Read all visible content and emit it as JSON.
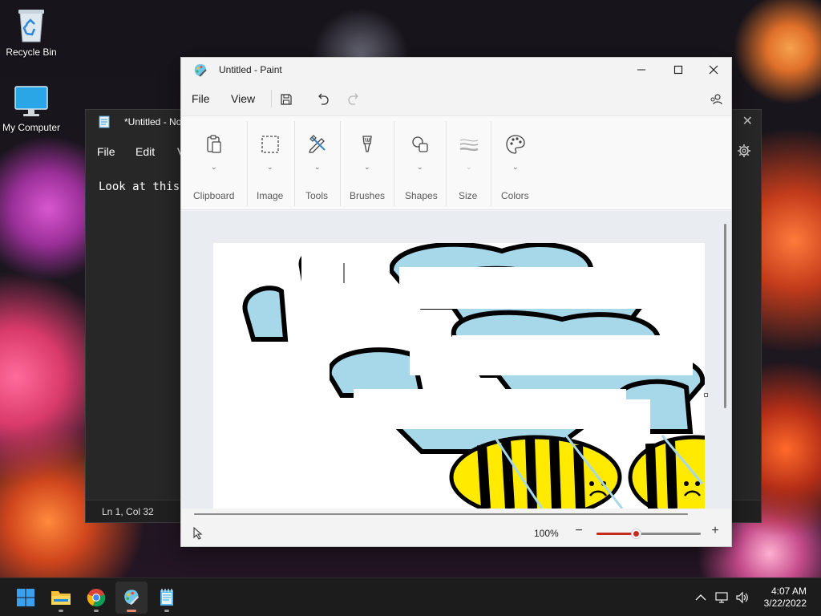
{
  "desktop": {
    "icons": [
      {
        "label": "Recycle Bin",
        "icon": "recycle-bin-icon"
      },
      {
        "label": "My Computer",
        "icon": "computer-monitor-icon"
      }
    ]
  },
  "notepad": {
    "title": "*Untitled - No",
    "menu": {
      "file": "File",
      "edit": "Edit",
      "view": "V"
    },
    "content": "Look at this.",
    "status": "Ln 1, Col 32"
  },
  "paint": {
    "title": "Untitled - Paint",
    "menu": {
      "file": "File",
      "view": "View"
    },
    "ribbon": {
      "groups": [
        {
          "label": "Clipboard",
          "icon": "clipboard-icon"
        },
        {
          "label": "Image",
          "icon": "select-rectangle-icon"
        },
        {
          "label": "Tools",
          "icon": "pencil-tools-icon"
        },
        {
          "label": "Brushes",
          "icon": "brush-icon"
        },
        {
          "label": "Shapes",
          "icon": "shapes-icon"
        },
        {
          "label": "Size",
          "icon": "stroke-size-icon"
        },
        {
          "label": "Colors",
          "icon": "palette-icon"
        }
      ]
    },
    "zoom": {
      "label": "100%",
      "level_percent": 100,
      "slider_fraction": 0.38
    }
  },
  "taskbar": {
    "apps": [
      {
        "name": "Start",
        "icon": "windows-start-icon"
      },
      {
        "name": "File Explorer",
        "icon": "folder-icon"
      },
      {
        "name": "Google Chrome",
        "icon": "chrome-icon"
      },
      {
        "name": "Paint",
        "icon": "paint-icon",
        "active": true
      },
      {
        "name": "Notepad",
        "icon": "notepad-icon"
      }
    ],
    "clock": {
      "time": "4:07 AM",
      "date": "3/22/2022"
    }
  },
  "colors": {
    "wing_blue": "#a6d8ea",
    "bee_yellow": "#ffea00",
    "slider_red": "#c42b1c"
  }
}
